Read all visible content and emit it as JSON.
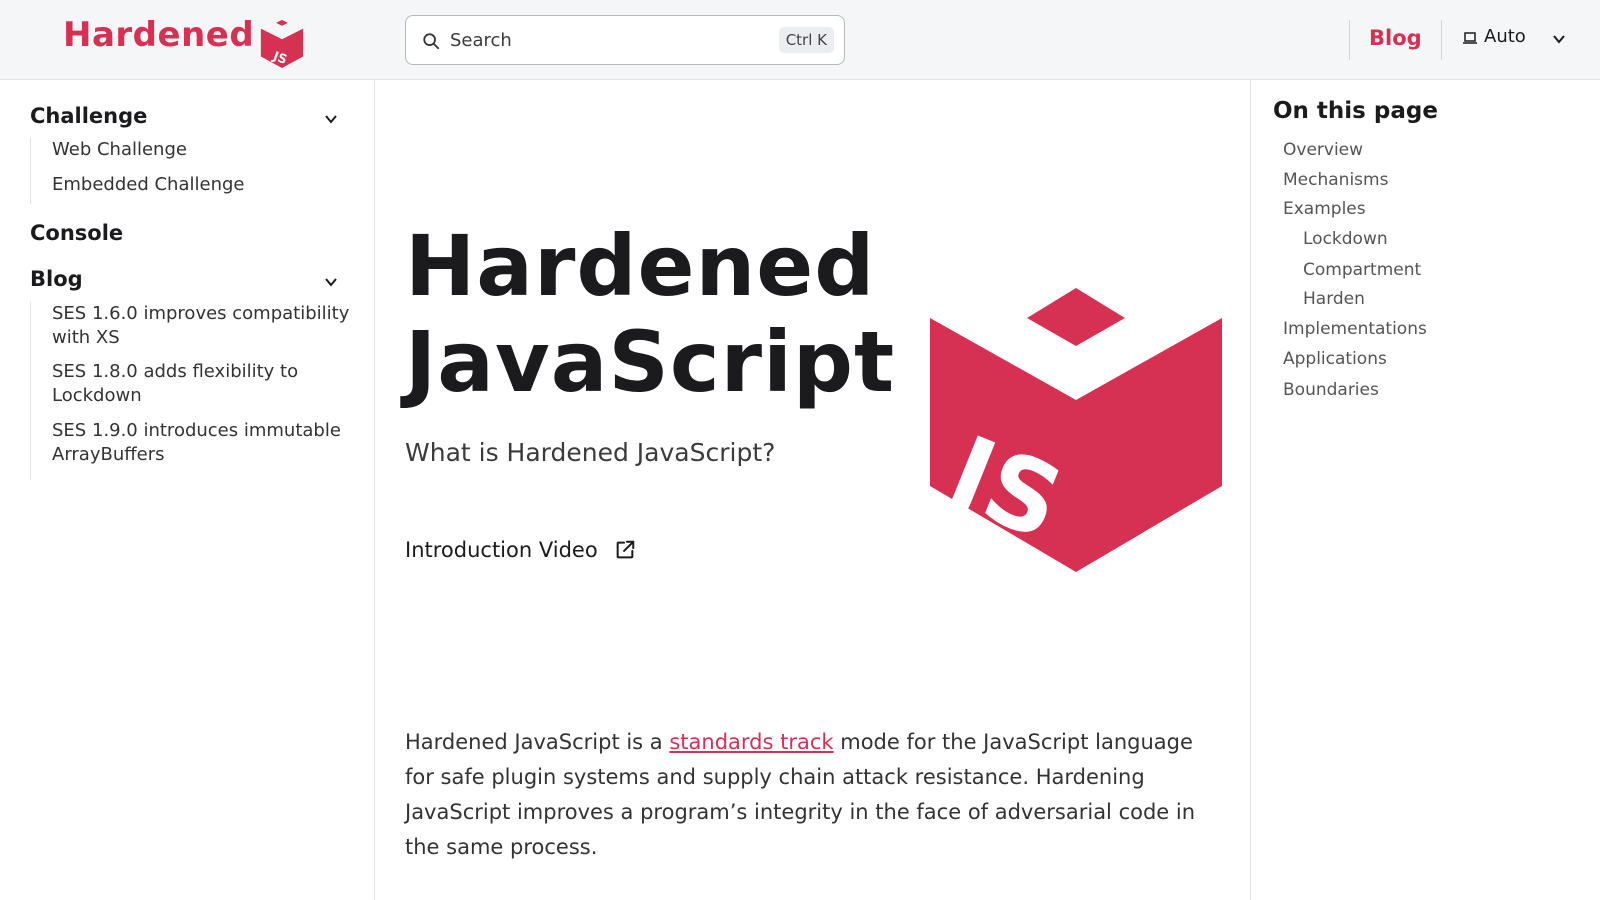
{
  "header": {
    "logo_text": "Hardened",
    "logo_badge": "JS",
    "search": {
      "placeholder": "Search",
      "shortcut": "Ctrl K"
    },
    "nav_blog": "Blog",
    "theme": {
      "label": "Auto",
      "icon": "laptop-icon"
    }
  },
  "sidebar": {
    "categories": [
      {
        "label": "Challenge",
        "expanded": true,
        "items": [
          "Web Challenge",
          "Embedded Challenge"
        ]
      },
      {
        "label": "Console"
      },
      {
        "label": "Blog",
        "expanded": true,
        "items": [
          [
            "SES 1.6.0 improves compatibility",
            "with XS"
          ],
          [
            "SES 1.8.0 adds flexibility to",
            "Lockdown"
          ],
          [
            "SES 1.9.0 introduces immutable",
            "ArrayBuffers"
          ]
        ]
      }
    ]
  },
  "main": {
    "title_line1": "Hardened",
    "title_line2": "JavaScript",
    "subtitle": "What is Hardened JavaScript?",
    "intro_video": "Introduction Video",
    "hero_logo_text": "JS",
    "paragraph": {
      "before": "Hardened JavaScript is a ",
      "link": "standards track",
      "after": " mode for the JavaScript language for safe plugin systems and supply chain attack resistance. Hardening JavaScript improves a program’s integrity in the face of adversarial code in the same process."
    }
  },
  "toc": {
    "title": "On this page",
    "items": [
      {
        "label": "Overview",
        "level": 1
      },
      {
        "label": "Mechanisms",
        "level": 1
      },
      {
        "label": "Examples",
        "level": 1
      },
      {
        "label": "Lockdown",
        "level": 2
      },
      {
        "label": "Compartment",
        "level": 2
      },
      {
        "label": "Harden",
        "level": 2
      },
      {
        "label": "Implementations",
        "level": 1
      },
      {
        "label": "Applications",
        "level": 1
      },
      {
        "label": "Boundaries",
        "level": 1
      }
    ]
  },
  "colors": {
    "brand": "#d63052",
    "text": "#1b1b1d",
    "header_bg": "#f5f6f7"
  }
}
